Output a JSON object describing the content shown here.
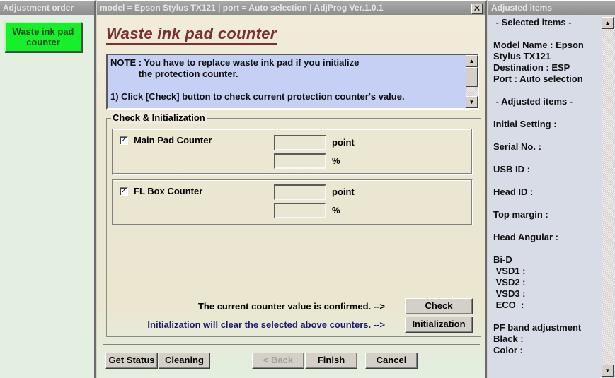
{
  "left_panel": {
    "title": "Adjustment order",
    "items": [
      {
        "label": "Waste ink pad\ncounter",
        "label_line1": "Waste ink pad",
        "label_line2": "counter",
        "active": true,
        "color": "#16f02a"
      }
    ]
  },
  "main_window": {
    "title": "model = Epson Stylus TX121 | port = Auto selection | AdjProg Ver.1.0.1",
    "close_icon": "close-icon",
    "page_title": "Waste ink pad counter",
    "note": {
      "line1": "NOTE : You have to replace waste ink pad if you initialize",
      "line2": "           the protection counter.",
      "line3": "",
      "line4": "1) Click [Check] button to check current protection counter's value."
    },
    "group": {
      "legend": "Check & Initialization",
      "counters": [
        {
          "label": "Main Pad Counter",
          "checked": true,
          "point_value": "",
          "percent_value": "",
          "point_unit": "point",
          "percent_unit": "%"
        },
        {
          "label": "FL Box Counter",
          "checked": true,
          "point_value": "",
          "percent_value": "",
          "point_unit": "point",
          "percent_unit": "%"
        }
      ],
      "check_text": "The current counter value is confirmed. -->",
      "check_button": "Check",
      "init_text": "Initialization will clear the selected above counters. -->",
      "init_button": "Initialization",
      "init_text_color": "#1a1a6e"
    },
    "footer": {
      "get_status": "Get Status",
      "cleaning": "Cleaning",
      "back": "< Back",
      "finish": "Finish",
      "cancel": "Cancel"
    }
  },
  "right_panel": {
    "title": "Adjusted items",
    "lines": [
      " - Selected items -",
      "",
      "Model Name : Epson",
      "Stylus TX121",
      "Destination : ESP",
      "Port : Auto selection",
      "",
      " - Adjusted items -",
      "",
      "Initial Setting :",
      "",
      "Serial No. :",
      "",
      "USB ID :",
      "",
      "Head ID :",
      "",
      "Top margin :",
      "",
      "Head Angular :",
      "",
      "Bi-D",
      " VSD1 :",
      " VSD2 :",
      " VSD3 :",
      " ECO  :",
      "",
      "PF band adjustment",
      "Black :",
      "Color :"
    ]
  }
}
